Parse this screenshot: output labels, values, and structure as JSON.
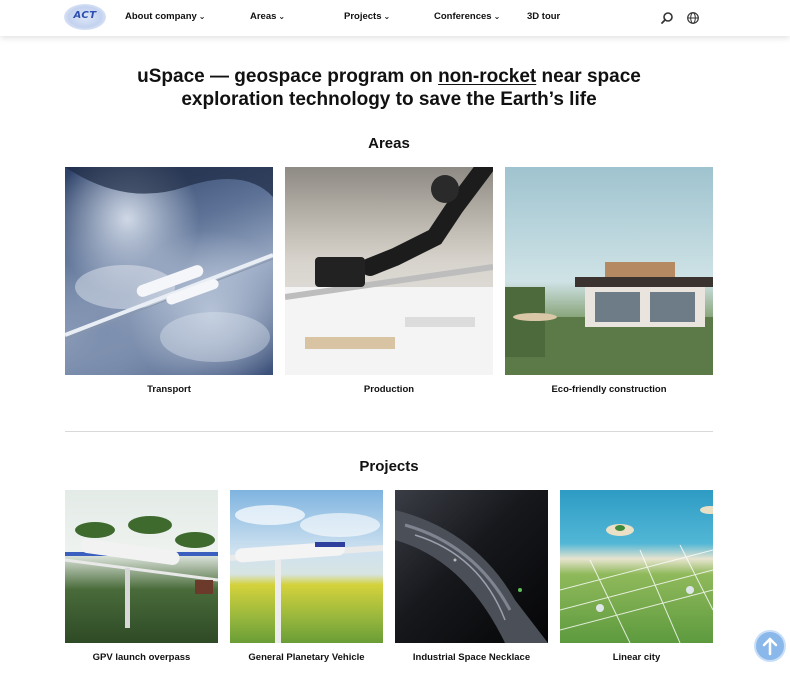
{
  "header": {
    "logo_text": "ACT",
    "nav": [
      {
        "label": "About company",
        "dropdown": true
      },
      {
        "label": "Areas",
        "dropdown": true
      },
      {
        "label": "Projects",
        "dropdown": true
      },
      {
        "label": "Conferences",
        "dropdown": true
      },
      {
        "label": "3D tour",
        "dropdown": false
      }
    ],
    "icons": [
      "search-icon",
      "globe-icon"
    ]
  },
  "hero": {
    "title_part1": "uSpace — geospace program on ",
    "title_link": "non-rocket",
    "title_part2": " near space exploration technology to save the Earth’s life"
  },
  "areas": {
    "title": "Areas",
    "items": [
      {
        "label": "Transport"
      },
      {
        "label": "Production"
      },
      {
        "label": "Eco-friendly construction"
      }
    ]
  },
  "projects": {
    "title": "Projects",
    "items": [
      {
        "label": "GPV launch overpass"
      },
      {
        "label": "General Planetary Vehicle"
      },
      {
        "label": "Industrial Space Necklace"
      },
      {
        "label": "Linear city"
      }
    ]
  },
  "colors": {
    "text": "#111111",
    "divider": "#d9d9d9",
    "scroll_button": "#8ab8ea"
  }
}
